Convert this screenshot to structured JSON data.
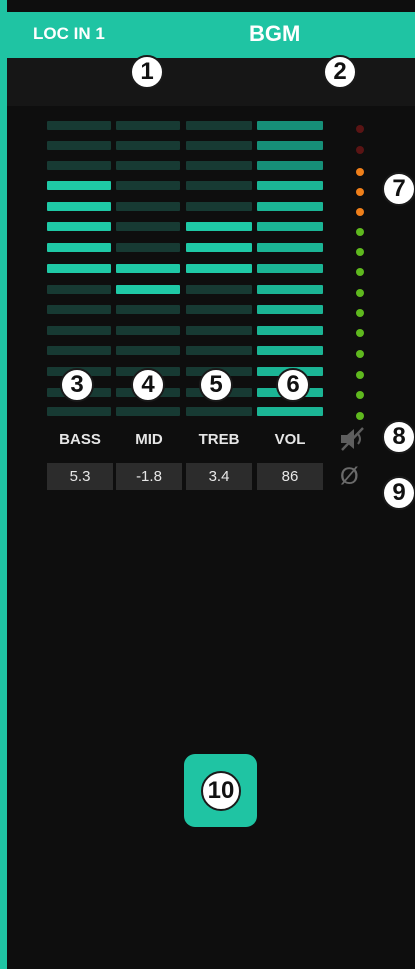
{
  "header": {
    "channel_name": "LOC IN 1",
    "assignment": "BGM"
  },
  "faders": [
    {
      "label": "BASS",
      "value": "5.3"
    },
    {
      "label": "MID",
      "value": "-1.8"
    },
    {
      "label": "TREB",
      "value": "3.4"
    },
    {
      "label": "VOL",
      "value": "86"
    }
  ],
  "icons": {
    "mute": "speaker-muted-icon",
    "phase": "phase-invert-icon"
  },
  "callouts": [
    "1",
    "2",
    "3",
    "4",
    "5",
    "6",
    "7",
    "8",
    "9",
    "10"
  ],
  "colors": {
    "accent": "#1fc4a3",
    "meter_green": "#5fb81e",
    "meter_orange": "#ef7f1a",
    "meter_red": "#5a1414"
  }
}
